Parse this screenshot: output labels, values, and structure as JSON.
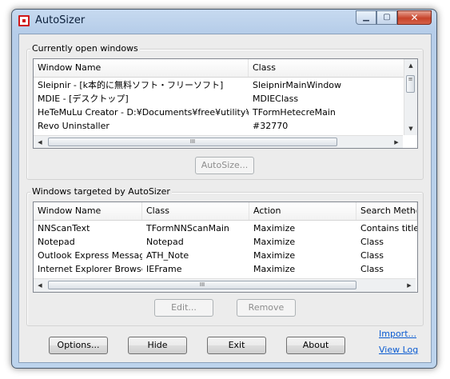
{
  "window": {
    "title": "AutoSizer",
    "caption": {
      "minimize": "▁",
      "maximize": "▢",
      "close": "✕"
    }
  },
  "open_windows": {
    "legend": "Currently open windows",
    "columns": [
      "Window Name",
      "Class"
    ],
    "rows": [
      [
        "Sleipnir - [k本的に無料ソフト・フリーソフト]",
        "SleipnirMainWindow"
      ],
      [
        "MDIE - [デスクトップ]",
        "MDIEClass"
      ],
      [
        "HeTeMuLu Creator - D:¥Documents¥free¥utility¥wi...",
        "TFormHetecreMain"
      ],
      [
        "Revo Uninstaller",
        "#32770"
      ]
    ],
    "autosize_label": "AutoSize..."
  },
  "targeted": {
    "legend": "Windows targeted by AutoSizer",
    "columns": [
      "Window Name",
      "Class",
      "Action",
      "Search Metho"
    ],
    "rows": [
      [
        "NNScanText",
        "TFormNNScanMain",
        "Maximize",
        "Contains title"
      ],
      [
        "Notepad",
        "Notepad",
        "Maximize",
        "Class"
      ],
      [
        "Outlook Express Message",
        "ATH_Note",
        "Maximize",
        "Class"
      ],
      [
        "Internet Explorer Browser",
        "IEFrame",
        "Maximize",
        "Class"
      ]
    ],
    "edit_label": "Edit...",
    "remove_label": "Remove"
  },
  "footer": {
    "options_label": "Options...",
    "hide_label": "Hide",
    "exit_label": "Exit",
    "about_label": "About",
    "import_link": "Import...",
    "viewlog_link": "View Log"
  },
  "scroll": {
    "up": "▲",
    "down": "▼",
    "left": "◀",
    "right": "▶",
    "grip_h": "III",
    "grip_v": "≡"
  }
}
